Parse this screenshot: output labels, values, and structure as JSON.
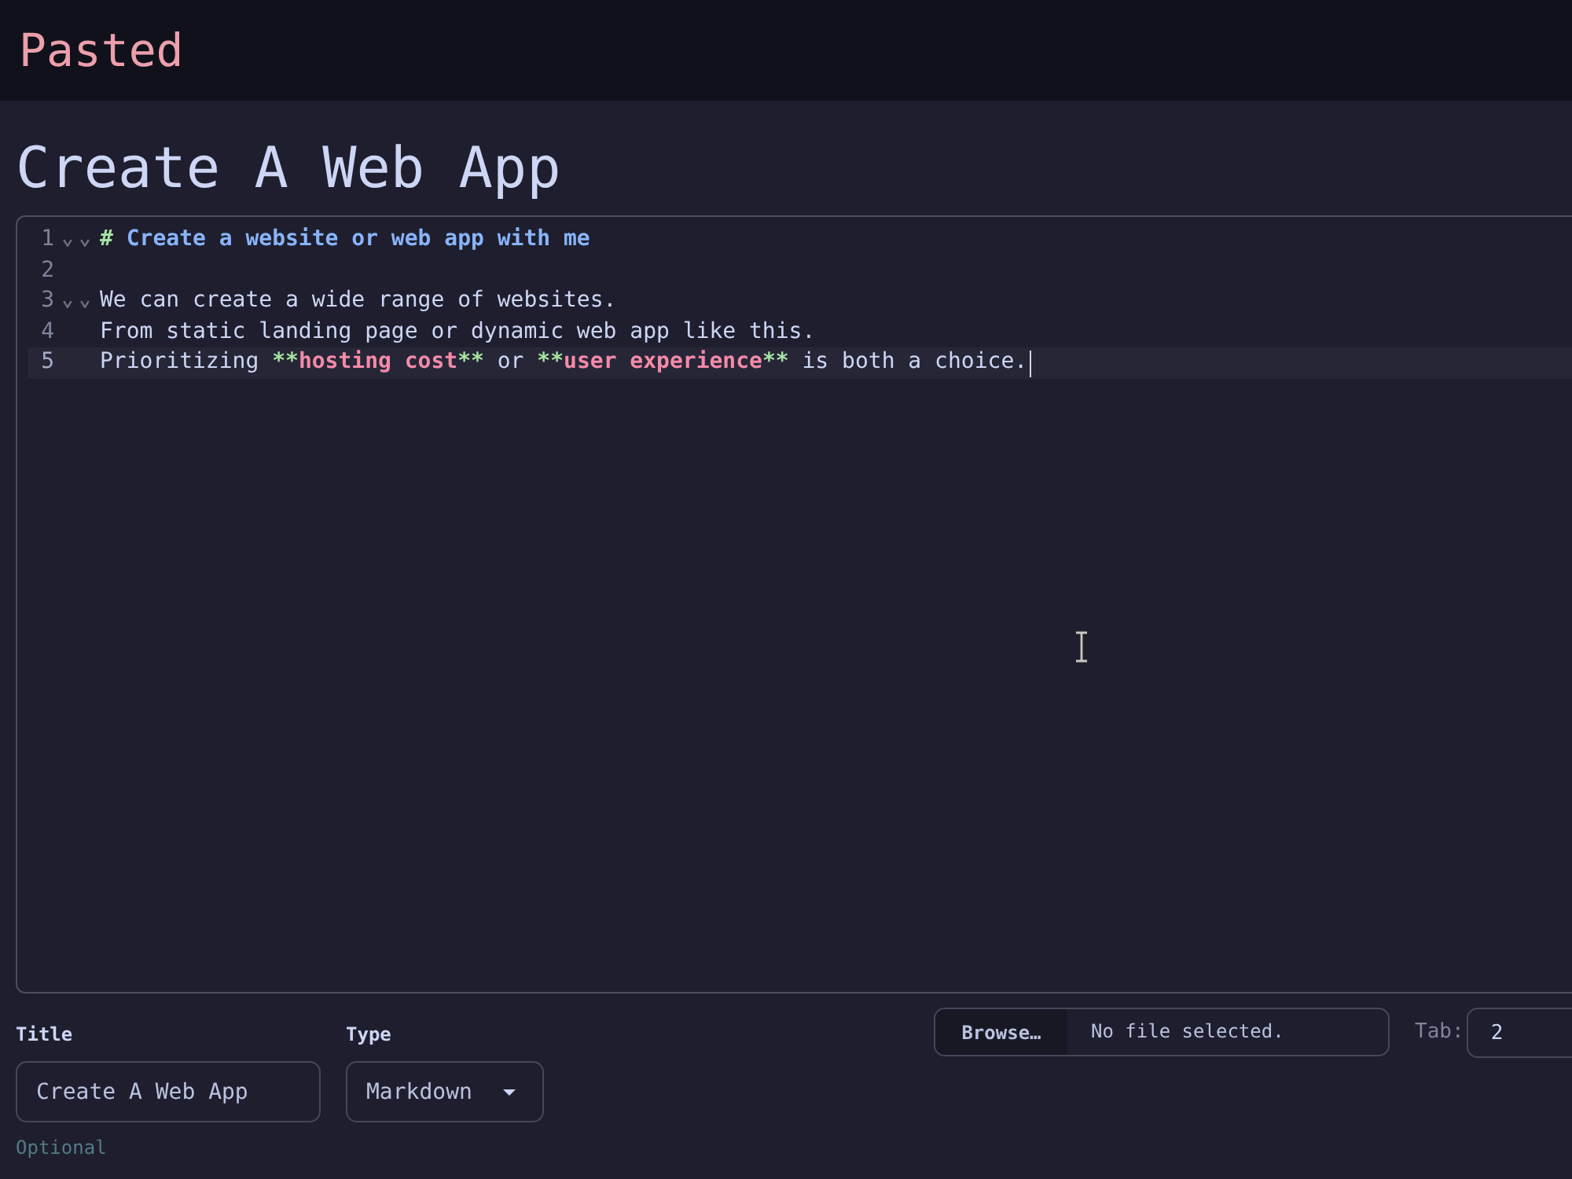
{
  "header": {
    "title": "Pasted"
  },
  "page_title": "Create A Web App",
  "editor": {
    "lines": [
      {
        "number": "1",
        "foldable": true,
        "active": false,
        "segments": [
          {
            "kind": "heading-mark",
            "text": "# "
          },
          {
            "kind": "heading",
            "text": "Create a website or web app with me"
          }
        ]
      },
      {
        "number": "2",
        "foldable": false,
        "active": false
      },
      {
        "number": "3",
        "foldable": true,
        "active": false,
        "segments": [
          {
            "kind": "text",
            "text": "We can create a wide range of websites."
          }
        ]
      },
      {
        "number": "4",
        "foldable": false,
        "active": false,
        "segments": [
          {
            "kind": "text",
            "text": "From static landing page or dynamic web app like this."
          }
        ]
      },
      {
        "number": "5",
        "foldable": false,
        "active": true,
        "segments": [
          {
            "kind": "text",
            "text": "Prioritizing "
          },
          {
            "kind": "bold-mark",
            "text": "**"
          },
          {
            "kind": "bold",
            "text": "hosting cost"
          },
          {
            "kind": "bold-mark",
            "text": "**"
          },
          {
            "kind": "text",
            "text": " or "
          },
          {
            "kind": "bold-mark",
            "text": "**"
          },
          {
            "kind": "bold",
            "text": "user experience"
          },
          {
            "kind": "bold-mark",
            "text": "**"
          },
          {
            "kind": "text",
            "text": " is both a choice."
          }
        ]
      }
    ]
  },
  "form": {
    "title_field": {
      "label": "Title",
      "value": "Create A Web App",
      "hint": "Optional"
    },
    "type_field": {
      "label": "Type",
      "value": "Markdown"
    },
    "file_picker": {
      "button": "Browse…",
      "status": "No file selected."
    },
    "tab_size": {
      "label": "Tab:",
      "value": "2"
    }
  }
}
